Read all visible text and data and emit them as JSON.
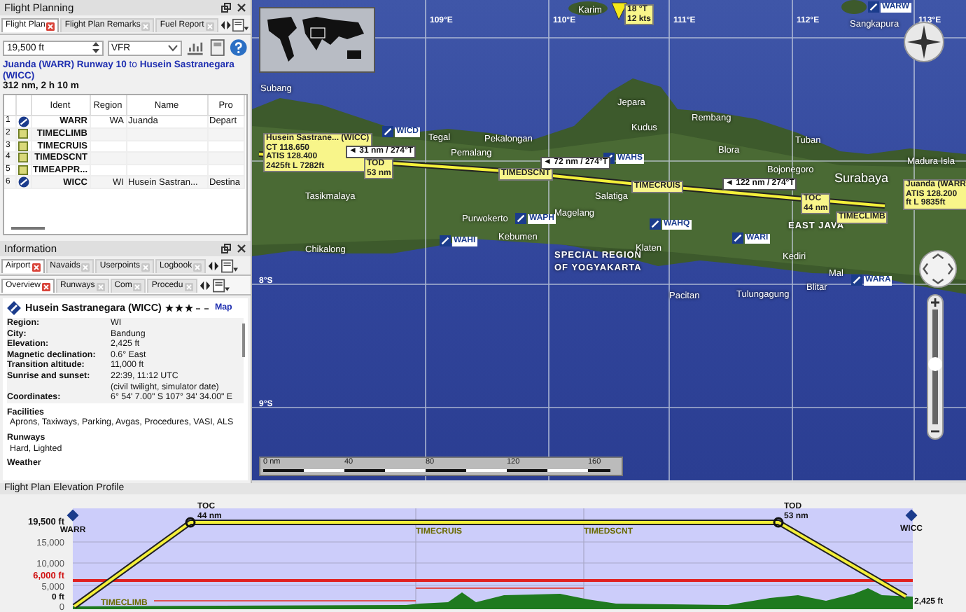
{
  "flight_planning": {
    "title": "Flight Planning",
    "tabs": [
      {
        "label": "Flight Plan",
        "selected": true
      },
      {
        "label": "Flight Plan Remarks",
        "selected": false
      },
      {
        "label": "Fuel Report",
        "selected": false
      }
    ],
    "altitude": "19,500 ft",
    "flight_rules": "VFR",
    "route": "**Juanda (WARR) Runway 10** to **Husein Sastranegara (WICC)**",
    "summary": "312 nm, 2 h 10 m",
    "columns": [
      "Ident",
      "Region",
      "Name",
      "Pro"
    ],
    "rows": [
      {
        "number": "1",
        "kind": "airport",
        "ident": "WARR",
        "region": "WA",
        "name": "Juanda",
        "procedure": "Depart"
      },
      {
        "number": "2",
        "kind": "userpoint",
        "ident": "TIMECLIMB"
      },
      {
        "number": "3",
        "kind": "userpoint",
        "ident": "TIMECRUIS"
      },
      {
        "number": "4",
        "kind": "userpoint",
        "ident": "TIMEDSCNT"
      },
      {
        "number": "5",
        "kind": "userpoint",
        "ident": "TIMEAPPR..."
      },
      {
        "number": "6",
        "kind": "airport",
        "ident": "WICC",
        "region": "WI",
        "name": "Husein Sastran...",
        "procedure": "Destina"
      }
    ]
  },
  "information": {
    "title": "Information",
    "tabs": [
      {
        "label": "Airport",
        "selected": true
      },
      {
        "label": "Navaids",
        "selected": false
      },
      {
        "label": "Userpoints",
        "selected": false
      },
      {
        "label": "Logbook",
        "selected": false
      }
    ],
    "subtabs": [
      {
        "label": "Overview",
        "selected": true
      },
      {
        "label": "Runways",
        "selected": false
      },
      {
        "label": "Com",
        "selected": false
      },
      {
        "label": "Procedu",
        "selected": false
      }
    ],
    "airport": "Husein Sastranegara (WICC)",
    "stars": 3,
    "map_link": "Map",
    "fields": [
      {
        "label": "Region:",
        "value": "WI"
      },
      {
        "label": "City:",
        "value": "Bandung"
      },
      {
        "label": "Elevation:",
        "value": "2,425 ft"
      },
      {
        "label": "Magnetic declination:",
        "value": "0.6° East"
      },
      {
        "label": "Transition altitude:",
        "value": "11,000 ft"
      },
      {
        "label": "Sunrise and sunset:",
        "value": "22:39, 11:12 UTC",
        "note": "(civil twilight, simulator date)"
      },
      {
        "label": "Coordinates:",
        "value": "6° 54' 7.00\" S 107° 34' 34.00\" E"
      }
    ],
    "sections": [
      {
        "heading": "Facilities",
        "text": "Aprons, Taxiways, Parking, Avgas, Procedures, VASI, ALS"
      },
      {
        "heading": "Runways",
        "text": "Hard, Lighted"
      },
      {
        "heading": "Weather"
      }
    ]
  },
  "map": {
    "labels": [
      {
        "kind": "grid",
        "text": "109°E"
      },
      {
        "kind": "grid",
        "text": "110°E"
      },
      {
        "kind": "grid",
        "text": "111°E"
      },
      {
        "kind": "grid",
        "text": "112°E"
      },
      {
        "kind": "grid",
        "text": "113°E"
      },
      {
        "kind": "grid",
        "text": "8°S"
      },
      {
        "kind": "grid",
        "text": "9°S"
      },
      {
        "kind": "city",
        "text": "Karim"
      },
      {
        "kind": "city",
        "text": "Sangkapura"
      },
      {
        "kind": "city",
        "text": "Subang"
      },
      {
        "kind": "city",
        "text": "Tegal"
      },
      {
        "kind": "city",
        "text": "Pekalongan"
      },
      {
        "kind": "city",
        "text": "Pemalang"
      },
      {
        "kind": "city",
        "text": "Jepara"
      },
      {
        "kind": "city",
        "text": "Kudus"
      },
      {
        "kind": "city",
        "text": "Rembang"
      },
      {
        "kind": "city",
        "text": "Tuban"
      },
      {
        "kind": "city",
        "text": "Blora"
      },
      {
        "kind": "city",
        "text": "Bojonegoro"
      },
      {
        "kind": "bigcity",
        "text": "Surabaya"
      },
      {
        "kind": "city",
        "text": "Madura Isla"
      },
      {
        "kind": "city",
        "text": "Tasikmalaya"
      },
      {
        "kind": "city",
        "text": "Purwokerto"
      },
      {
        "kind": "city",
        "text": "Magelang"
      },
      {
        "kind": "city",
        "text": "Salatiga"
      },
      {
        "kind": "city",
        "text": "Kebumen"
      },
      {
        "kind": "city",
        "text": "Chikalong"
      },
      {
        "kind": "region",
        "text": "EAST JAVA"
      },
      {
        "kind": "region",
        "text": "SPECIAL REGION"
      },
      {
        "kind": "region",
        "text": "OF YOGYAKARTA"
      },
      {
        "kind": "city",
        "text": "Klaten"
      },
      {
        "kind": "city",
        "text": "Kediri"
      },
      {
        "kind": "city",
        "text": "Pacitan"
      },
      {
        "kind": "city",
        "text": "Tulungagung"
      },
      {
        "kind": "city",
        "text": "Blitar"
      },
      {
        "kind": "city",
        "text": "Mal"
      },
      {
        "kind": "airport",
        "text": "WARW"
      },
      {
        "kind": "airport",
        "text": "WICD"
      },
      {
        "kind": "airport",
        "text": "WAHS"
      },
      {
        "kind": "airport",
        "text": "WAPH"
      },
      {
        "kind": "airport",
        "text": "WAHQ"
      },
      {
        "kind": "airport",
        "text": "WARI"
      },
      {
        "kind": "airport",
        "text": "WAHI"
      },
      {
        "kind": "airport",
        "text": "WARA"
      }
    ],
    "zoom_slider": {
      "level": 0.57
    },
    "route_labels": [
      {
        "kind": "info",
        "lines": [
          "Husein Sastrane... (WICC)",
          "CT 118.650",
          "ATIS 128.400",
          "2425ft L 7282ft"
        ]
      },
      {
        "kind": "leg",
        "lines": [
          "◄ 31 nm / 274°T"
        ]
      },
      {
        "kind": "point",
        "lines": [
          "TOD",
          "53 nm"
        ]
      },
      {
        "kind": "point",
        "lines": [
          "TIMEDSCNT"
        ]
      },
      {
        "kind": "leg",
        "lines": [
          "◄ 72 nm / 274°T"
        ]
      },
      {
        "kind": "point",
        "lines": [
          "TIMECRUIS"
        ]
      },
      {
        "kind": "leg",
        "lines": [
          "◄ 122 nm / 274°T"
        ]
      },
      {
        "kind": "point",
        "lines": [
          "TOC",
          "44 nm"
        ]
      },
      {
        "kind": "point",
        "lines": [
          "TIMECLIMB"
        ]
      },
      {
        "kind": "info",
        "lines": [
          "Juanda (WARR",
          "ATIS 128.200",
          "ft L 9835ft"
        ]
      },
      {
        "kind": "point",
        "lines": [
          "18 °T",
          "12 kts"
        ]
      }
    ],
    "scale": [
      "0 nm",
      "40",
      "80",
      "120",
      "160"
    ]
  },
  "profile": {
    "title": "Flight Plan Elevation Profile",
    "axis_labels": [
      {
        "kind": "main",
        "text": "19,500 ft"
      },
      {
        "kind": "tick",
        "text": "15,000"
      },
      {
        "kind": "tick",
        "text": "10,000"
      },
      {
        "kind": "safe",
        "text": "6,000 ft"
      },
      {
        "kind": "tick",
        "text": "5,000"
      },
      {
        "kind": "tick",
        "text": "0"
      }
    ],
    "points": [
      {
        "kind": "airport",
        "lines": [
          "WARR"
        ]
      },
      {
        "kind": "top",
        "lines": [
          "TOC",
          "44 nm"
        ]
      },
      {
        "kind": "point",
        "lines": [
          "TIMECRUIS"
        ]
      },
      {
        "kind": "point",
        "lines": [
          "TIMEDSCNT"
        ]
      },
      {
        "kind": "top",
        "lines": [
          "TOD",
          "53 nm"
        ]
      },
      {
        "kind": "airport",
        "lines": [
          "WICC"
        ]
      },
      {
        "kind": "value",
        "lines": [
          "0 ft"
        ]
      },
      {
        "kind": "point",
        "lines": [
          "TIMECLIMB"
        ]
      },
      {
        "kind": "value",
        "lines": [
          "2,425 ft"
        ]
      }
    ]
  }
}
